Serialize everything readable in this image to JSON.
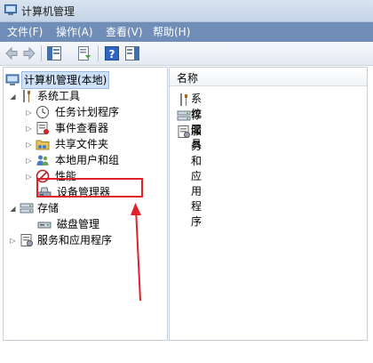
{
  "window": {
    "title": "计算机管理"
  },
  "menu": [
    "文件(F)",
    "操作(A)",
    "查看(V)",
    "帮助(H)"
  ],
  "toolbar": {
    "icons": [
      "back-arrow-icon",
      "forward-arrow-icon",
      "console-tree-icon",
      "export-list-icon",
      "help-icon",
      "show-hide-action-pane-icon"
    ]
  },
  "tree": {
    "root": "计算机管理(本地)",
    "system_tools": "系统工具",
    "task_scheduler": "任务计划程序",
    "event_viewer": "事件查看器",
    "shared_folders": "共享文件夹",
    "local_users": "本地用户和组",
    "performance": "性能",
    "device_manager": "设备管理器",
    "storage": "存储",
    "disk_management": "磁盘管理",
    "services_apps": "服务和应用程序"
  },
  "list": {
    "column_header": "名称",
    "items": [
      "系统工具",
      "存储",
      "服务和应用程序"
    ]
  },
  "colors": {
    "menubar": "#6f8db6",
    "highlight_box": "#e0202a"
  }
}
